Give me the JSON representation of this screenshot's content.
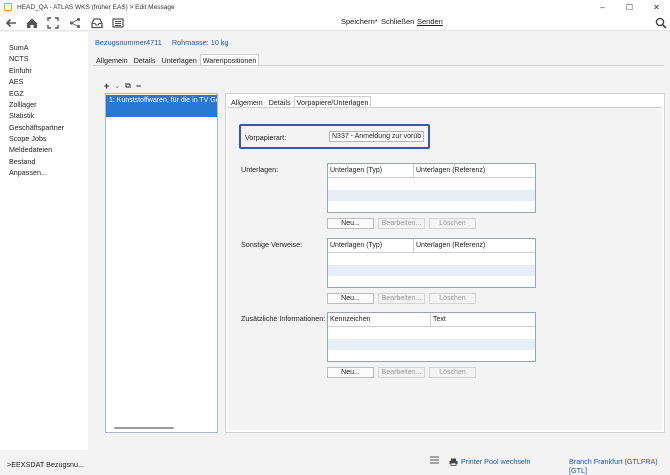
{
  "window": {
    "title": "HEAD_QA - ATLAS WKS (früher EAS) > Edit Message",
    "controls": [
      "–",
      "☐",
      "✕"
    ]
  },
  "toolbar": {
    "icons": [
      "back-arrow-icon",
      "home-icon",
      "expand-icon",
      "share-icon",
      "inbox-icon",
      "list-icon",
      "search-icon"
    ],
    "save_label": "Speichern*",
    "close_label": "Schließen",
    "send_label": "Senden"
  },
  "sidebar": {
    "items": [
      {
        "label": "SumA"
      },
      {
        "label": "NCTS"
      },
      {
        "label": "Einfuhr"
      },
      {
        "label": "AES"
      },
      {
        "label": "EGZ"
      },
      {
        "label": "Zolllager"
      },
      {
        "label": "Statistik"
      },
      {
        "label": "Geschäftspartner"
      },
      {
        "label": "Scope Jobs"
      },
      {
        "label": "Meldedateien"
      },
      {
        "label": "Bestand"
      },
      {
        "label": "Anpassen..."
      }
    ]
  },
  "header": {
    "reference": "Bezugsnummer4711",
    "mass": "Rohmasse: 10 kg"
  },
  "main_tabs": [
    {
      "label": "Allgemein"
    },
    {
      "label": "Details"
    },
    {
      "label": "Unterlagen"
    },
    {
      "label": "Warenpositionen",
      "active": true
    }
  ],
  "positions": {
    "toolbar": {
      "add": "+",
      "add_menu": "⌄",
      "copy": "⧉",
      "remove": "−"
    },
    "items": [
      {
        "label": "1:   Kunststoffwaren, für die in TV Ge"
      }
    ]
  },
  "detail_tabs": [
    {
      "label": "Allgemein"
    },
    {
      "label": "Details"
    },
    {
      "label": "Vorpapiere/Unterlagen",
      "active": true
    }
  ],
  "vorpapier": {
    "label": "Vorpapierart:",
    "value": "N337 - Anmeldung zur vorüb"
  },
  "sections": [
    {
      "label": "Unterlagen:",
      "columns": [
        "Unterlagen (Typ)",
        "Unterlagen (Referenz)"
      ],
      "buttons": {
        "new": "Neu...",
        "edit": "Bearbeiten...",
        "delete": "Löschen"
      }
    },
    {
      "label": "Sonstige Verweise:",
      "columns": [
        "Unterlagen (Typ)",
        "Unterlagen (Referenz)"
      ],
      "buttons": {
        "new": "Neu...",
        "edit": "Bearbeiten...",
        "delete": "Löschen"
      }
    },
    {
      "label": "Zusätzliche Informationen:",
      "columns": [
        "Kennzeichen",
        "Text"
      ],
      "buttons": {
        "new": "Neu...",
        "edit": "Bearbeiten...",
        "delete": "Löschen"
      }
    }
  ],
  "statusbar": {
    "left": ">EEXSDAT Bezugsnu...",
    "printer": "Printer Pool wechseln",
    "branch": "Branch Frankfurt (GTLFRA) [GTL]"
  },
  "colors": {
    "accent": "#2a78d6",
    "link": "#1f5aa6",
    "highlight_border": "#3856b8"
  }
}
